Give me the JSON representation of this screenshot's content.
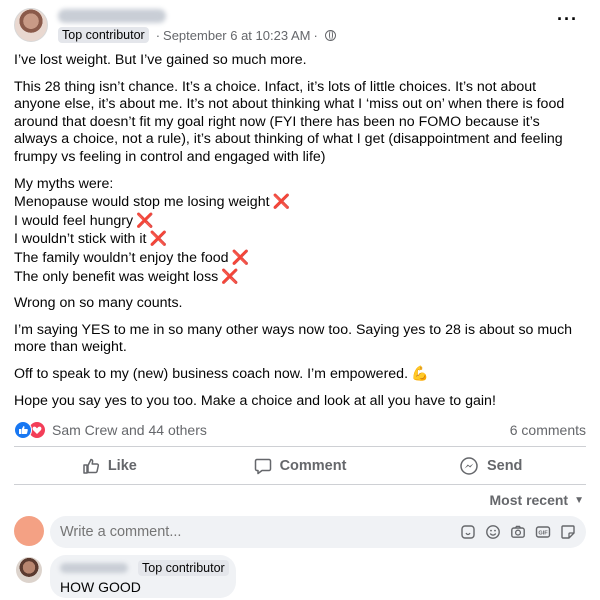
{
  "post": {
    "author_badge": "Top contributor",
    "meta_sep": "·",
    "timestamp": "September 6 at 10:23 AM",
    "timestamp_suffix": "·",
    "paragraphs": {
      "p1": "I’ve lost weight. But I’ve gained so much more.",
      "p2": "This 28 thing isn’t chance. It’s a choice. Infact, it’s lots of little choices. It’s not about anyone else, it’s about me. It’s not about thinking what I ‘miss out on’ when there is food around that doesn’t fit my goal right now (FYI there has been no FOMO because it’s always a choice, not a rule), it’s about thinking of what I get (disappointment and feeling frumpy vs feeling in control and engaged with life)",
      "myths_heading": "My myths were:",
      "myths": [
        "Menopause would stop me losing weight",
        "I would feel hungry",
        "I wouldn’t stick with it",
        "The family wouldn’t enjoy the food",
        "The only benefit was weight loss"
      ],
      "myth_mark": "❌",
      "p3": "Wrong on so many counts.",
      "p4": "I’m saying YES to me in so many other ways now too. Saying yes to 28 is about so much more than weight.",
      "p5": "Off to speak to my (new) business coach now. I’m empowered.",
      "p5_emoji": "💪",
      "p6": "Hope you say yes to you too. Make a choice and look at all you have to gain!"
    }
  },
  "reactions": {
    "names": "Sam Crew and 44 others",
    "comments": "6 comments"
  },
  "actions": {
    "like": "Like",
    "comment": "Comment",
    "send": "Send"
  },
  "comments_section": {
    "sort_label": "Most recent",
    "composer_placeholder": "Write a comment...",
    "composer_icons": [
      "sticker-icon",
      "emoji-icon",
      "camera-icon",
      "gif-icon",
      "sticker-face-icon"
    ],
    "first_comment": {
      "badge": "Top contributor",
      "text": "HOW GOOD"
    }
  },
  "colors": {
    "accent": "#1877f2",
    "love": "#f33e58",
    "myth_mark": "#e02b3a",
    "muted_text": "#65676b"
  }
}
